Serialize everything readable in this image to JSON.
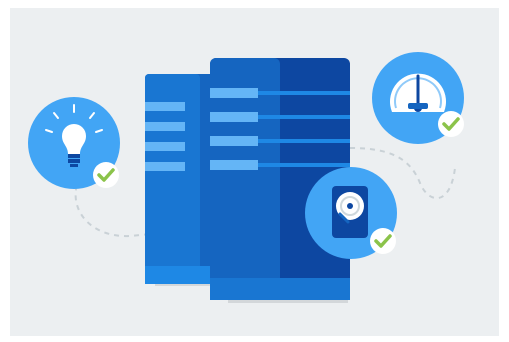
{
  "illustration": {
    "theme": "server-hosting-features",
    "colors": {
      "background": "#eceff1",
      "server_dark": "#0d47a1",
      "server_mid": "#1565c0",
      "server_light": "#1e88e5",
      "slot": "#64b5f6",
      "badge_circle": "#42a5f5",
      "badge_ring": "#90caf9",
      "check": "#8bc34a",
      "check_bg": "#ffffff",
      "dash": "#c9d1d6"
    },
    "badges": [
      {
        "name": "idea",
        "icon": "lightbulb-icon",
        "checked": true
      },
      {
        "name": "speed",
        "icon": "speedometer-icon",
        "checked": true
      },
      {
        "name": "storage",
        "icon": "hard-drive-icon",
        "checked": true
      }
    ],
    "servers": [
      {
        "name": "back-server",
        "slots": 4
      },
      {
        "name": "front-server",
        "slots": 4
      }
    ]
  }
}
